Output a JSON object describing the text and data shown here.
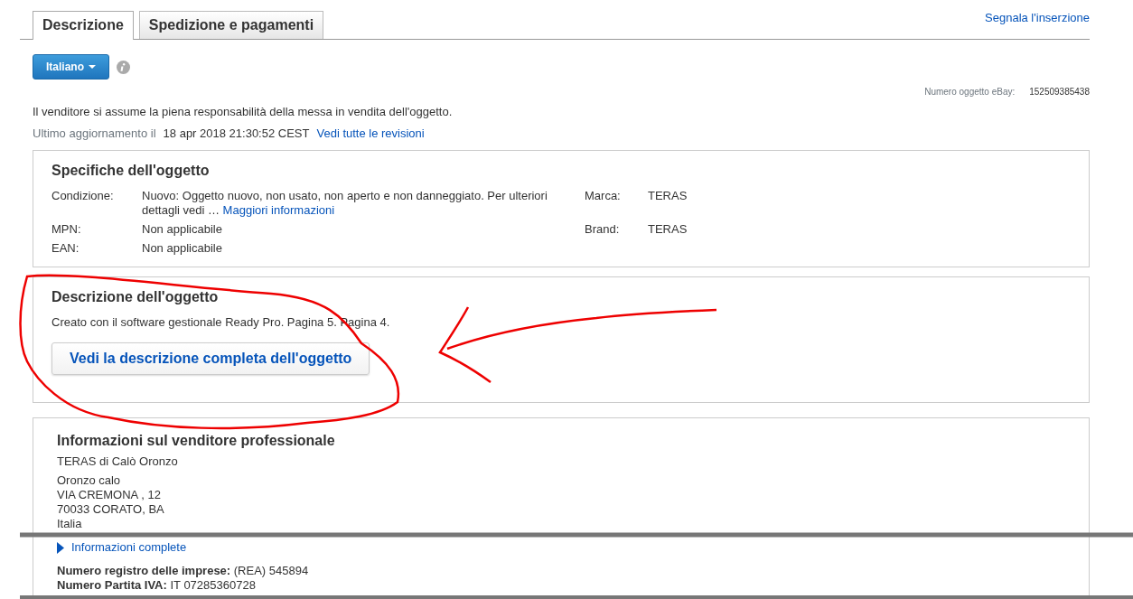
{
  "tabs": [
    {
      "label": "Descrizione",
      "selected": true
    },
    {
      "label": "Spedizione e pagamenti",
      "selected": false
    }
  ],
  "report_link": "Segnala l'inserzione",
  "language_button": "Italiano",
  "item_number": {
    "label": "Numero oggetto eBay:",
    "value": "152509385438"
  },
  "responsibility": "Il venditore si assume la piena responsabilità della messa in vendita dell'oggetto.",
  "last_update": {
    "label": "Ultimo aggiornamento il",
    "date": "18 apr 2018 21:30:52 CEST",
    "link": "Vedi tutte le revisioni"
  },
  "specifics": {
    "title": "Specifiche dell'oggetto",
    "rows": [
      [
        {
          "label": "Condizione:",
          "value": "Nuovo: Oggetto nuovo, non usato, non aperto e non danneggiato. Per ulteriori dettagli vedi …",
          "link": "Maggiori informazioni"
        },
        {
          "label": "Marca:",
          "value": "TERAS"
        }
      ],
      [
        {
          "label": "MPN:",
          "value": "Non applicabile"
        },
        {
          "label": "Brand:",
          "value": "TERAS"
        }
      ],
      [
        {
          "label": "EAN:",
          "value": "Non applicabile"
        }
      ]
    ]
  },
  "description": {
    "title": "Descrizione dell'oggetto",
    "text": "Creato con il software gestionale Ready Pro. Pagina 5. Pagina 4.",
    "button": "Vedi la descrizione completa dell'oggetto"
  },
  "seller": {
    "title": "Informazioni sul venditore professionale",
    "company": "TERAS di Calò Oronzo",
    "address": [
      "Oronzo calo",
      "VIA CREMONA , 12",
      "70033 CORATO, BA",
      "Italia"
    ],
    "details_link": "Informazioni complete",
    "facts": [
      {
        "label": "Numero registro delle imprese:",
        "value": "(REA) 545894"
      },
      {
        "label": "Numero Partita IVA:",
        "value": "IT 07285360728"
      }
    ]
  }
}
